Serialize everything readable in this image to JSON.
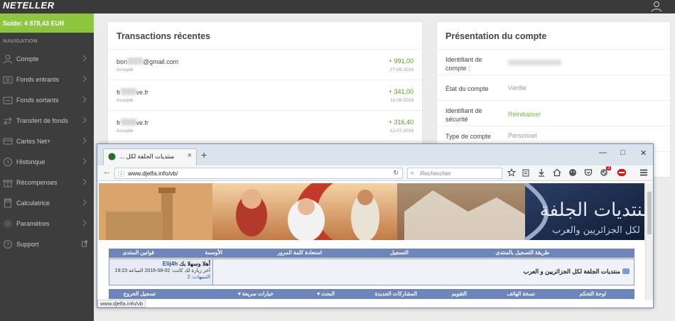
{
  "app": {
    "logo": "NETELLER"
  },
  "sidebar": {
    "balance": "Solde: 4 878,43 EUR",
    "heading": "NAVIGATION",
    "items": [
      {
        "label": "Compte",
        "icon": "user-icon"
      },
      {
        "label": "Fonds entrants",
        "icon": "deposit-icon"
      },
      {
        "label": "Fonds sortants",
        "icon": "withdraw-icon"
      },
      {
        "label": "Transfert de fonds",
        "icon": "transfer-icon"
      },
      {
        "label": "Cartes Net+",
        "icon": "card-icon"
      },
      {
        "label": "Historique",
        "icon": "clock-icon"
      },
      {
        "label": "Récompenses",
        "icon": "gift-icon"
      },
      {
        "label": "Calculatrice",
        "icon": "calculator-icon"
      },
      {
        "label": "Paramètres",
        "icon": "gear-icon"
      },
      {
        "label": "Support",
        "icon": "help-icon"
      }
    ]
  },
  "transactions": {
    "title": "Transactions récentes",
    "items": [
      {
        "email_start": "bon",
        "email_end": "@gmail.com",
        "status": "Accepté",
        "amount": "+ 991,00",
        "date": "27-08-2016"
      },
      {
        "email_start": "fr",
        "email_end": "ve.fr",
        "status": "Accepté",
        "amount": "+ 341,00",
        "date": "11-08-2016"
      },
      {
        "email_start": "fr",
        "email_end": "ve.fr",
        "status": "Accepté",
        "amount": "+ 316,40",
        "date": "12-07-2016"
      }
    ]
  },
  "account": {
    "title": "Présentation du compte",
    "rows": [
      {
        "label": "Identifiant de compte :",
        "value": ""
      },
      {
        "label": "État du compte",
        "value": "Vérifié"
      },
      {
        "label": "Identifiant de sécurité",
        "value": "Réinitialiser"
      },
      {
        "label": "Type de compte",
        "value": "Personnel"
      }
    ]
  },
  "browser": {
    "tab_title": "منتديات الجلفة لكل ...",
    "new_tab": "+",
    "url": "www.djelfa.info/vb/",
    "search_placeholder": "Rechercher",
    "badge_count": "3",
    "status_url": "www.djelfa.info/vb"
  },
  "forum": {
    "nav1": [
      "طريقة التسجيل بالمنتدى",
      "التسجيل",
      "استعادة كلمة المرور",
      "الأوسمة",
      "قوانين المنتدى"
    ],
    "title": "منتديات الجلفة لكل الجزائريين و العرب",
    "welcome_prefix": "أهلا وسهلا بك",
    "username": "Elij4h",
    "last_visit": "آخر زيارة لك كانت: 02-08-2016 الساعة 19:23",
    "notifications": "التنبيهات: 2",
    "nav2": [
      "لوحة التحكم",
      "نسخة الهاتف",
      "التقويم",
      "المشاركات الجديدة",
      "البحث ▾",
      "خيارات سريعة ▾",
      "تسجيل الخروج"
    ]
  }
}
